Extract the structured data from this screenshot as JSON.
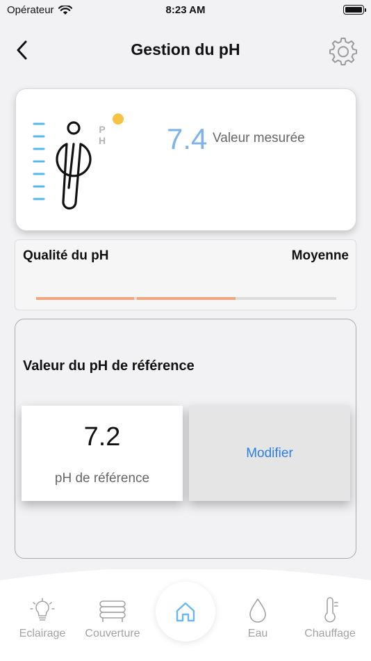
{
  "status_bar": {
    "carrier": "Opérateur",
    "time": "8:23 AM"
  },
  "header": {
    "title": "Gestion du pH"
  },
  "measurement": {
    "value": "7.4",
    "label": "Valeur mesurée",
    "ph_glyph_p": "P",
    "ph_glyph_h": "H",
    "status_color": "#f6c343"
  },
  "quality": {
    "title": "Qualité du pH",
    "value": "Moyenne",
    "level_fraction": 0.67
  },
  "reference": {
    "title": "Valeur du pH de référence",
    "value": "7.2",
    "value_label": "pH de référence",
    "modify_label": "Modifier"
  },
  "tabs": [
    {
      "label": "Eclairage",
      "icon": "lightbulb-icon"
    },
    {
      "label": "Couverture",
      "icon": "pool-cover-icon"
    },
    {
      "label": "",
      "icon": "home-icon",
      "active": true
    },
    {
      "label": "Eau",
      "icon": "water-drop-icon"
    },
    {
      "label": "Chauffage",
      "icon": "thermometer-icon"
    }
  ],
  "colors": {
    "accent": "#7eb2ea",
    "link": "#2b7fe0",
    "quality_bar": "#f4a37b",
    "tab_inactive": "#a2a2a6",
    "home_icon": "#6ab6ee"
  }
}
